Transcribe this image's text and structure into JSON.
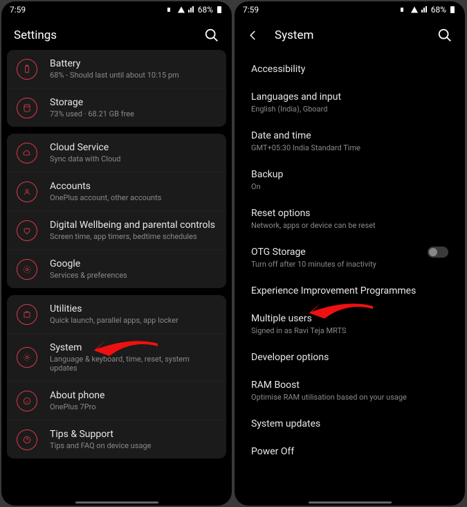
{
  "statusbar": {
    "time": "7:59",
    "battery_pct": "68%"
  },
  "left": {
    "title": "Settings",
    "groups": [
      {
        "rows": [
          {
            "icon": "battery-icon",
            "title": "Battery",
            "sub": "68% - Should last until about 10:15 pm"
          },
          {
            "icon": "storage-icon",
            "title": "Storage",
            "sub": "73% used · 68.21 GB free"
          }
        ]
      },
      {
        "rows": [
          {
            "icon": "cloud-icon",
            "title": "Cloud Service",
            "sub": "Sync data with Cloud"
          },
          {
            "icon": "account-icon",
            "title": "Accounts",
            "sub": "OnePlus account, other accounts"
          },
          {
            "icon": "heart-icon",
            "title": "Digital Wellbeing and parental controls",
            "sub": "Screen time, app timers, bedtime schedules"
          },
          {
            "icon": "google-icon",
            "title": "Google",
            "sub": "Services & preferences"
          }
        ]
      },
      {
        "rows": [
          {
            "icon": "utilities-icon",
            "title": "Utilities",
            "sub": "Quick launch, parallel apps, app locker"
          },
          {
            "icon": "system-icon",
            "title": "System",
            "sub": "Language & keyboard, time, reset, system updates"
          },
          {
            "icon": "about-icon",
            "title": "About phone",
            "sub": "OnePlus 7Pro"
          },
          {
            "icon": "tips-icon",
            "title": "Tips & Support",
            "sub": "Tips and FAQ on device usage"
          }
        ]
      }
    ]
  },
  "right": {
    "title": "System",
    "rows": [
      {
        "title": "Accessibility",
        "sub": ""
      },
      {
        "title": "Languages and input",
        "sub": "English (India), Gboard"
      },
      {
        "title": "Date and time",
        "sub": "GMT+05:30 India Standard Time"
      },
      {
        "title": "Backup",
        "sub": "On"
      },
      {
        "title": "Reset options",
        "sub": "Network, apps or device can be reset"
      },
      {
        "title": "OTG Storage",
        "sub": "Turn off after 10 minutes of inactivity",
        "toggle": true
      },
      {
        "title": "Experience Improvement Programmes",
        "sub": ""
      },
      {
        "title": "Multiple users",
        "sub": "Signed in as Ravi Teja MRTS"
      },
      {
        "title": "Developer options",
        "sub": ""
      },
      {
        "title": "RAM Boost",
        "sub": "Optimise RAM utilisation based on your usage"
      },
      {
        "title": "System updates",
        "sub": ""
      },
      {
        "title": "Power Off",
        "sub": ""
      }
    ]
  }
}
